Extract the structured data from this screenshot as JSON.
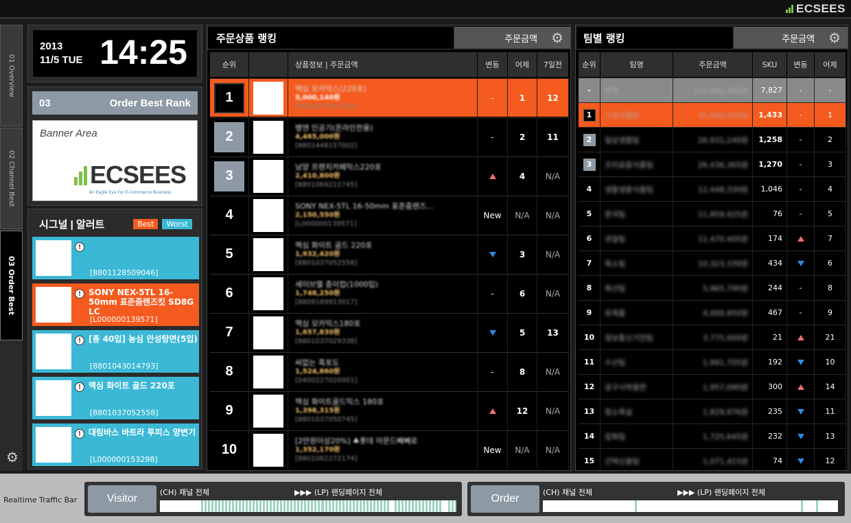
{
  "app": {
    "logo": "ECSEES"
  },
  "tabs": [
    {
      "label": "01 Overview"
    },
    {
      "label": "02 Channel Best"
    },
    {
      "label": "03 Order Best"
    }
  ],
  "clock": {
    "year": "2013",
    "date": "11/5 TUE",
    "time": "14:25"
  },
  "rank_panel": {
    "number": "03",
    "title": "Order Best Rank"
  },
  "banner": {
    "label": "Banner Area",
    "logo": "ECSEES",
    "tagline": "An Eagle Eye For E-Commerce Business"
  },
  "signal": {
    "title": "시그널 | 알러트",
    "best_label": "Best",
    "worst_label": "Worst",
    "items": [
      {
        "name": "",
        "code": "[8801128509046]",
        "color": "#3bb8d6"
      },
      {
        "name": "SONY NEX-5TL 16-50mm 표준줌렌즈킷 SD8G LC",
        "code": "[L000000139571]",
        "color": "#f55a1e"
      },
      {
        "name": "[총 40입] 농심 안성탕면(5입)",
        "code": "[8801043014793]",
        "color": "#3bb8d6"
      },
      {
        "name": "맥심 화이트 골드 220포",
        "code": "[8801037052558]",
        "color": "#3bb8d6"
      },
      {
        "name": "대림바스 바트라 투피스 양변기",
        "code": "[L000000153298]",
        "color": "#3bb8d6"
      }
    ]
  },
  "product_ranking": {
    "title": "주문상품 랭킹",
    "selector": "주문금액",
    "columns": [
      "순위",
      "",
      "상품정보 | 주문금액",
      "변동",
      "어제",
      "7일전"
    ],
    "rows": [
      {
        "rank": "1",
        "name": "맥심 모카믹스(220포)",
        "price": "5,000,140원",
        "code": "[8801037047202]",
        "change": "-",
        "yesterday": "1",
        "week": "12"
      },
      {
        "rank": "2",
        "name": "뱅앤 인공기(온라인전용)",
        "price": "4,465,000원",
        "code": "[8801448157002]",
        "change": "-",
        "yesterday": "2",
        "week": "11"
      },
      {
        "rank": "3",
        "name": "남양 프렌치카페믹스220포",
        "price": "2,410,800원",
        "code": "[8801069222745]",
        "change": "up",
        "yesterday": "4",
        "week": "N/A"
      },
      {
        "rank": "4",
        "name": "SONY NEX-5TL 16-50mm 표준줌렌즈...",
        "price": "2,150,550원",
        "code": "[L000000139571]",
        "change": "New",
        "yesterday": "N/A",
        "week": "N/A"
      },
      {
        "rank": "5",
        "name": "맥심 화이트 골드 220포",
        "price": "1,932,420원",
        "code": "[8801037052558]",
        "change": "down",
        "yesterday": "3",
        "week": "N/A"
      },
      {
        "rank": "6",
        "name": "세이브엘 종이컵(1000입)",
        "price": "1,748,250원",
        "code": "[8809189913017]",
        "change": "-",
        "yesterday": "6",
        "week": "N/A"
      },
      {
        "rank": "7",
        "name": "맥심 모카믹스180포",
        "price": "1,657,830원",
        "code": "[8801037029338]",
        "change": "down",
        "yesterday": "5",
        "week": "13"
      },
      {
        "rank": "8",
        "name": "씨없는 흑포도",
        "price": "1,524,860원",
        "code": "[0400227020001]",
        "change": "-",
        "yesterday": "8",
        "week": "N/A"
      },
      {
        "rank": "9",
        "name": "맥심 화이트골드믹스 180포",
        "price": "1,398,315원",
        "code": "[8801037050745]",
        "change": "up",
        "yesterday": "12",
        "week": "N/A"
      },
      {
        "rank": "10",
        "name": "[2만원이상20%] ♣롯데 아몬드빼빼로",
        "price": "1,352,170원",
        "code": "[8801062272174]",
        "change": "New",
        "yesterday": "N/A",
        "week": "N/A"
      }
    ]
  },
  "team_ranking": {
    "title": "팀별 랭킹",
    "selector": "주문금액",
    "columns": [
      "순위",
      "팀명",
      "주문금액",
      "SKU",
      "변동",
      "어제"
    ],
    "total": {
      "rank": "-",
      "team": "전체",
      "amount": "230,841,395원",
      "sku": "7,827",
      "change": "-",
      "yesterday": "-"
    },
    "rows": [
      {
        "rank": "1",
        "team": "가공식품팀",
        "amount": "35,564,455원",
        "sku": "1,433",
        "change": "-",
        "yesterday": "1"
      },
      {
        "rank": "2",
        "team": "일상생활팀",
        "amount": "26,931,240원",
        "sku": "1,258",
        "change": "-",
        "yesterday": "2"
      },
      {
        "rank": "3",
        "team": "조미료음식품팀",
        "amount": "26,436,365원",
        "sku": "1,270",
        "change": "-",
        "yesterday": "3"
      },
      {
        "rank": "4",
        "team": "생활생용식품팀",
        "amount": "12,448,330원",
        "sku": "1,046",
        "change": "-",
        "yesterday": "4"
      },
      {
        "rank": "5",
        "team": "완국팀",
        "amount": "11,859,425원",
        "sku": "76",
        "change": "-",
        "yesterday": "5"
      },
      {
        "rank": "6",
        "team": "과일팀",
        "amount": "11,470,405원",
        "sku": "174",
        "change": "up",
        "yesterday": "7"
      },
      {
        "rank": "7",
        "team": "육소팀",
        "amount": "10,323,339원",
        "sku": "434",
        "change": "down",
        "yesterday": "6"
      },
      {
        "rank": "8",
        "team": "축산팀",
        "amount": "5,965,790원",
        "sku": "244",
        "change": "-",
        "yesterday": "8"
      },
      {
        "rank": "9",
        "team": "유제품",
        "amount": "4,000,950원",
        "sku": "467",
        "change": "-",
        "yesterday": "9"
      },
      {
        "rank": "10",
        "team": "정보통신기전팀",
        "amount": "3,775,000원",
        "sku": "21",
        "change": "up",
        "yesterday": "21"
      },
      {
        "rank": "11",
        "team": "수산팀",
        "amount": "1,991,705원",
        "sku": "192",
        "change": "down",
        "yesterday": "10"
      },
      {
        "rank": "12",
        "team": "공구시락용판",
        "amount": "1,957,090원",
        "sku": "300",
        "change": "up",
        "yesterday": "14"
      },
      {
        "rank": "13",
        "team": "청소욕실",
        "amount": "1,829,976원",
        "sku": "235",
        "change": "down",
        "yesterday": "11"
      },
      {
        "rank": "14",
        "team": "잡화팀",
        "amount": "1,725,645원",
        "sku": "232",
        "change": "down",
        "yesterday": "13"
      },
      {
        "rank": "15",
        "team": "간택신용팀",
        "amount": "1,071,415원",
        "sku": "74",
        "change": "down",
        "yesterday": "12"
      }
    ]
  },
  "traffic": {
    "label": "Realtime Traffic Bar",
    "visitor": {
      "button": "Visitor",
      "ch": "(CH) 채널 전체",
      "lp": "▶▶▶ (LP) 랜딩페이지 전체"
    },
    "order": {
      "button": "Order",
      "ch": "(CH) 채널 전체",
      "lp": "▶▶▶ (LP) 랜딩페이지 전체"
    }
  },
  "colors": {
    "accent": "#f55a1e",
    "signal": "#3bb8d6",
    "steel": "#8d9aa5",
    "up": "#f07070",
    "down": "#2b8ae6"
  }
}
